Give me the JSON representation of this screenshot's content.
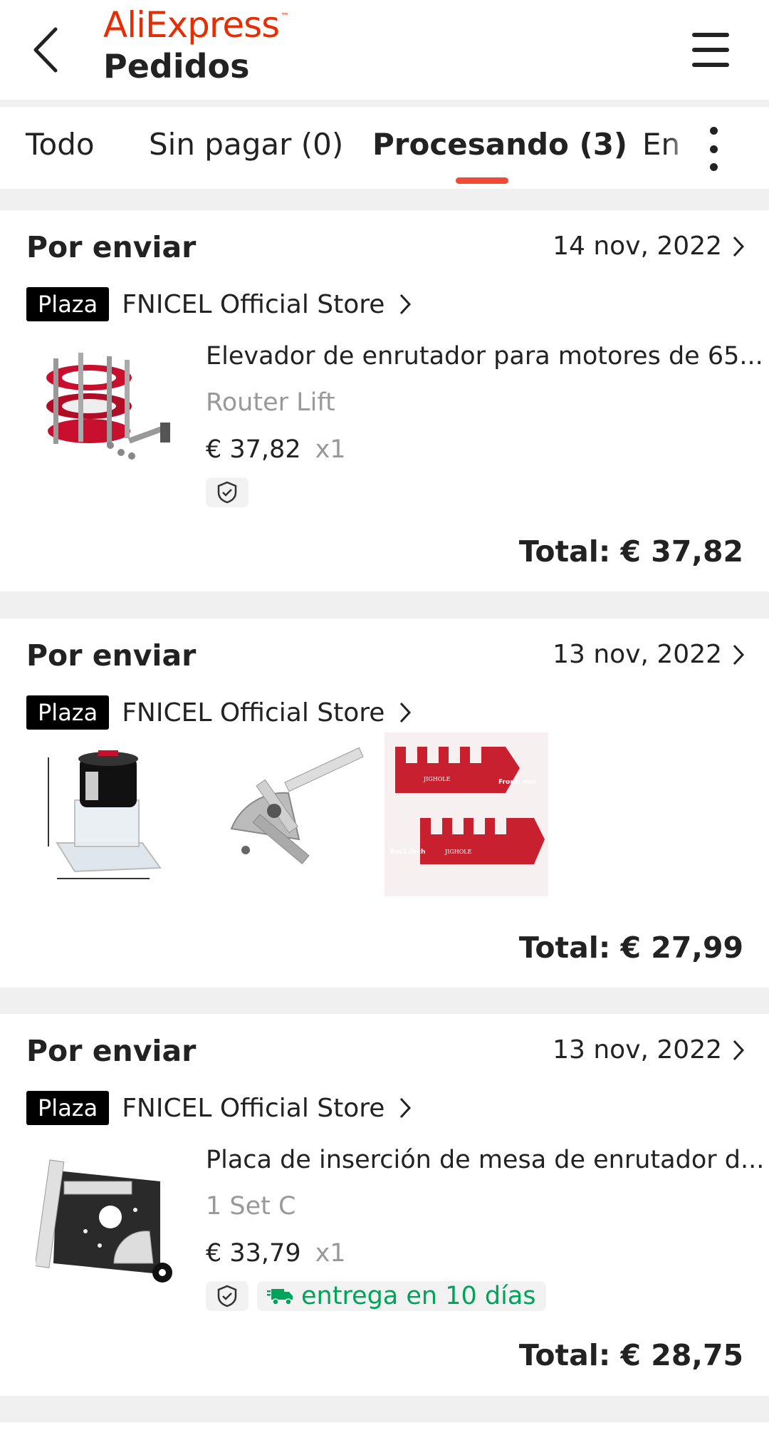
{
  "header": {
    "brand": "AliExpress",
    "brand_mark": "™",
    "title": "Pedidos",
    "back_icon": "chevron-left-icon",
    "menu_icon": "hamburger-menu-icon"
  },
  "tabs": [
    {
      "label": "Todo",
      "active": false
    },
    {
      "label": "Sin pagar (0)",
      "active": false
    },
    {
      "label": "Procesando (3)",
      "active": true
    },
    {
      "label": "En",
      "active": false
    }
  ],
  "colors": {
    "brand": "#e62e04",
    "accent": "#f04a35",
    "delivery": "#00a35a"
  },
  "orders": [
    {
      "status": "Por enviar",
      "date": "14 nov, 2022",
      "badge": "Plaza",
      "store": "FNICEL Official Store",
      "item": {
        "title": "Elevador de enrutador para motores de 65...",
        "variant": "Router Lift",
        "price": "€ 37,82",
        "qty": "x1"
      },
      "total": "Total: € 37,82"
    },
    {
      "status": "Por enviar",
      "date": "13 nov, 2022",
      "badge": "Plaza",
      "store": "FNICEL Official Store",
      "total": "Total: € 27,99"
    },
    {
      "status": "Por enviar",
      "date": "13 nov, 2022",
      "badge": "Plaza",
      "store": "FNICEL Official Store",
      "item": {
        "title": "Placa de inserción de mesa de enrutador d...",
        "variant": "1 Set C",
        "price": "€ 33,79",
        "qty": "x1",
        "delivery": "entrega en 10 días"
      },
      "total": "Total: € 28,75"
    }
  ],
  "product_images": {
    "jig_labels": {
      "brand": "JIGHOLE",
      "front": "Front: mm",
      "back": "Back:Inch"
    }
  }
}
